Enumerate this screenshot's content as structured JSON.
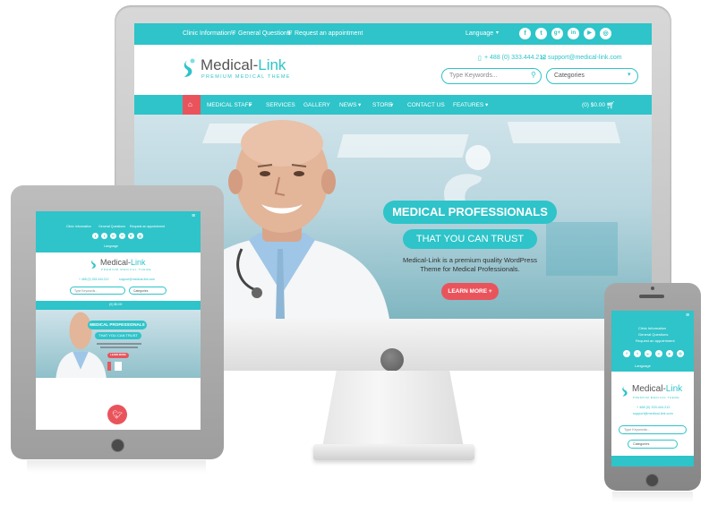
{
  "desktop": {
    "topbar": {
      "links": [
        "Clinic Information",
        "General Questions",
        "Request an appointment"
      ],
      "language": "Language",
      "social": [
        {
          "icon": "facebook-icon",
          "glyph": "f"
        },
        {
          "icon": "twitter-icon",
          "glyph": "t"
        },
        {
          "icon": "google-plus-icon",
          "glyph": "g+"
        },
        {
          "icon": "linkedin-icon",
          "glyph": "in"
        },
        {
          "icon": "youtube-icon",
          "glyph": "▶"
        },
        {
          "icon": "dribbble-icon",
          "glyph": "◎"
        }
      ]
    },
    "brand": {
      "name_main": "Medical-",
      "name_accent": "Link",
      "tagline": "PREMIUM MEDICAL THEME"
    },
    "contact": {
      "phone": "+ 488 (0) 333.444.212",
      "email": "support@medical-link.com"
    },
    "search": {
      "placeholder": "Type Keywords..."
    },
    "categories": {
      "label": "Categories"
    },
    "nav": {
      "items": [
        "MEDICAL STAFF",
        "SERVICES",
        "GALLERY",
        "NEWS",
        "STORE",
        "CONTACT US",
        "FEATURES"
      ],
      "cart": "(0) $0.00"
    },
    "hero": {
      "title": "MEDICAL PROFESSIONALS",
      "subtitle": "THAT YOU CAN TRUST",
      "desc_line1": "Medical-Link is a premium quality WordPress",
      "desc_line2": "Theme for Medical Professionals.",
      "button": "LEARN MORE"
    }
  },
  "tablet": {
    "topbar": {
      "links": [
        "Clinic Information",
        "General Questions",
        "Request an appointment"
      ],
      "language": "Language"
    },
    "brand": {
      "name_main": "Medical-",
      "name_accent": "Link",
      "tagline": "PREMIUM MEDICAL THEME"
    },
    "contact": {
      "phone": "+ 488 (0) 333.444.212",
      "email": "support@medical-link.com"
    },
    "search": {
      "placeholder": "Type Keywords..."
    },
    "categories": {
      "label": "Categories"
    },
    "cart": "(0) $0.00",
    "hero": {
      "title": "MEDICAL PROFESSIONALS",
      "subtitle": "THAT YOU CAN TRUST",
      "button": "LEARN MORE"
    }
  },
  "phone": {
    "topbar": {
      "links": [
        "Clinic Information",
        "General Questions",
        "Request an appointment"
      ],
      "language": "Language"
    },
    "brand": {
      "name_main": "Medical-",
      "name_accent": "Link",
      "tagline": "PREMIUM MEDICAL THEME"
    },
    "contact": {
      "phone": "+ 488 (0) 333.444.212",
      "email": "support@medical-link.com"
    },
    "search": {
      "placeholder": "Type Keywords..."
    },
    "categories": {
      "label": "Categories"
    }
  },
  "colors": {
    "accent": "#2ec4c9",
    "cta": "#e9545c",
    "device_frame": "#b0b0b0"
  }
}
